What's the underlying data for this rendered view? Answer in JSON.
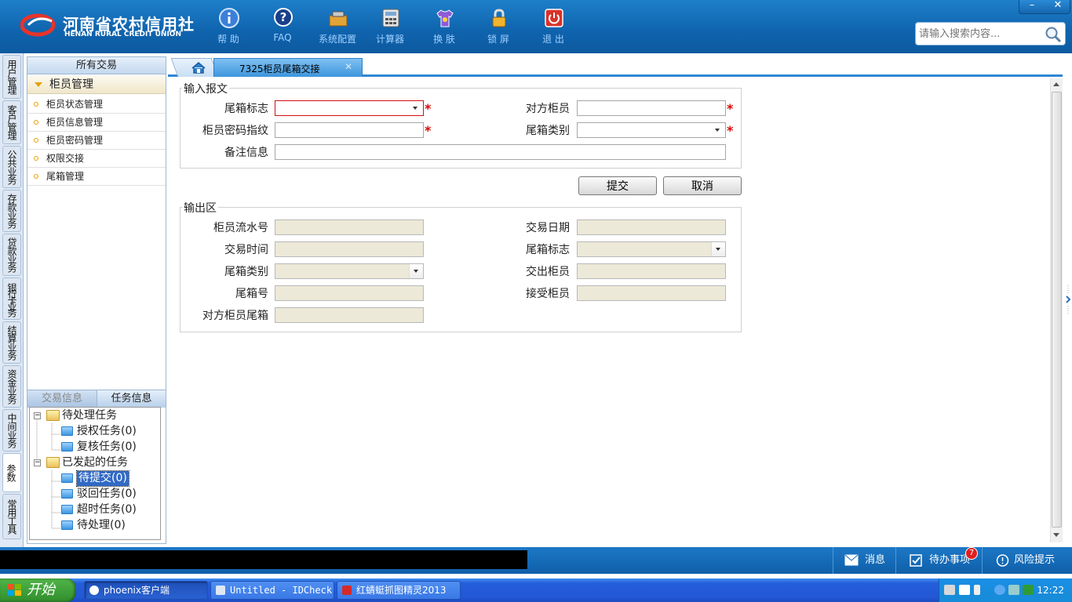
{
  "header": {
    "brand_cn": "河南省农村信用社",
    "brand_en": "HENAN RURAL CREDIT UNION",
    "toolbar": [
      {
        "label": "帮 助",
        "icon": "info-icon"
      },
      {
        "label": "FAQ",
        "icon": "faq-icon"
      },
      {
        "label": "系统配置",
        "icon": "toolbox-icon"
      },
      {
        "label": "计算器",
        "icon": "calculator-icon"
      },
      {
        "label": "换 肤",
        "icon": "shirt-icon"
      },
      {
        "label": "锁 屏",
        "icon": "lock-icon"
      },
      {
        "label": "退 出",
        "icon": "power-icon"
      }
    ],
    "window_controls": {
      "minimize": "–",
      "close": "✕"
    },
    "search_placeholder": "请输入搜索内容..."
  },
  "vertical_tabs": [
    "用户管理",
    "客户管理",
    "公共业务",
    "存款业务",
    "贷款业务",
    "银行卡业务",
    "结算业务",
    "资金业务",
    "中间业务",
    "参数",
    "常用工具"
  ],
  "left_panel": {
    "title": "所有交易",
    "group": "柜员管理",
    "items": [
      "柜员状态管理",
      "柜员信息管理",
      "柜员密码管理",
      "权限交接",
      "尾箱管理"
    ],
    "tabs": [
      "交易信息",
      "任务信息"
    ],
    "tree": {
      "pending": "待处理任务",
      "auth": "授权任务(0)",
      "review": "复核任务(0)",
      "initiated": "已发起的任务",
      "to_submit": "待提交(0)",
      "rejected": "驳回任务(0)",
      "timeout": "超时任务(0)",
      "to_process": "待处理(0)"
    }
  },
  "tabs": {
    "home_icon": "home-icon",
    "active_tab": "7325柜员尾箱交接",
    "close": "✕"
  },
  "input_section": {
    "legend": "输入报文",
    "box_flag_label": "尾箱标志",
    "box_flag_value": "",
    "peer_teller_label": "对方柜员",
    "peer_teller_value": "",
    "password_label": "柜员密码指纹",
    "password_value": "",
    "box_type_label": "尾箱类别",
    "box_type_value": "",
    "remark_label": "备注信息",
    "remark_value": "",
    "required_mark": "*"
  },
  "buttons": {
    "submit": "提交",
    "cancel": "取消"
  },
  "output_section": {
    "legend": "输出区",
    "serial_label": "柜员流水号",
    "trade_date_label": "交易日期",
    "trade_time_label": "交易时间",
    "box_flag_label": "尾箱标志",
    "box_type_label": "尾箱类别",
    "handover_label": "交出柜员",
    "box_no_label": "尾箱号",
    "receiver_label": "接受柜员",
    "peer_box_label": "对方柜员尾箱"
  },
  "statusbar": {
    "messages": "消息",
    "todo": "待办事项",
    "todo_count": "7",
    "risk": "风险提示"
  },
  "taskbar": {
    "start": "开始",
    "tasks": [
      "phoenix客户端",
      "Untitled - IDCheck",
      "红蜻蜓抓图精灵2013"
    ],
    "clock": "12:22"
  },
  "colors": {
    "header_blue": "#0f63ad",
    "accent": "#2f86d4",
    "required": "#dd0000"
  }
}
